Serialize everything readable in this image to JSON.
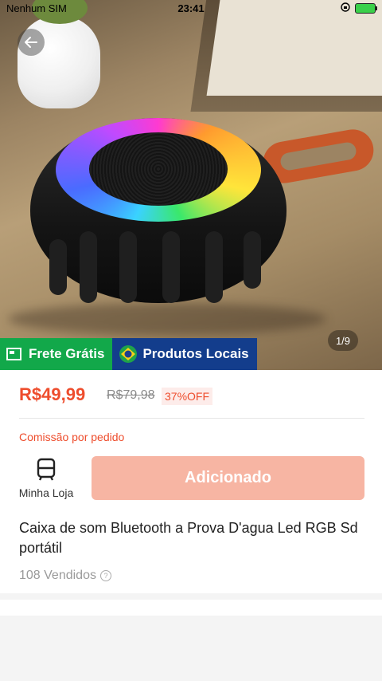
{
  "status_bar": {
    "carrier": "Nenhum SIM",
    "time": "23:41"
  },
  "gallery": {
    "counter": "1/9"
  },
  "badges": {
    "shipping": "Frete Grátis",
    "local": "Produtos Locais"
  },
  "product": {
    "price": "R$49,99",
    "original_price": "R$79,98",
    "discount": "37%OFF",
    "commission_label": "Comissão por pedido",
    "title": "Caixa de som Bluetooth a Prova D'agua Led RGB Sd portátil",
    "sold": "108 Vendidos"
  },
  "actions": {
    "store_label": "Minha Loja",
    "add_label": "Adicionado"
  },
  "colors": {
    "accent": "#ee4d2d",
    "badge_green": "#12a84a",
    "badge_blue": "#133d8c",
    "button_disabled": "#f7b5a3"
  }
}
